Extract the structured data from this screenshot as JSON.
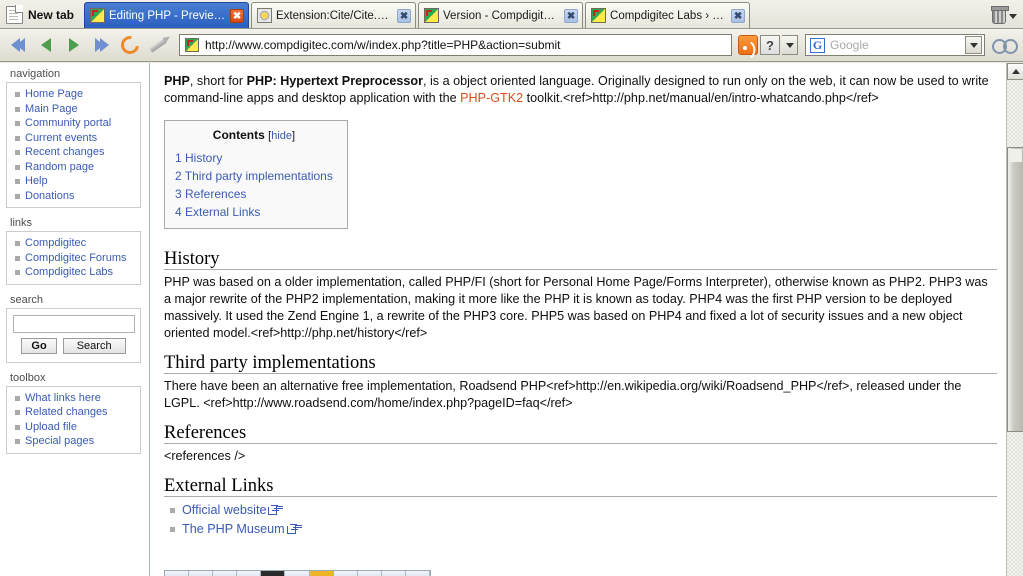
{
  "browser": {
    "new_tab_label": "New tab",
    "trash_icon": "trash-icon",
    "tabs": [
      {
        "title": "Editing PHP - Preview ...",
        "favicon": "compdigitec-favicon",
        "close_label": "✖",
        "active": true
      },
      {
        "title": "Extension:Cite/Cite.ph...",
        "favicon": "mediawiki-favicon",
        "close_label": "✖",
        "active": false
      },
      {
        "title": "Version - Compdigitec...",
        "favicon": "compdigitec-favicon",
        "close_label": "✖",
        "active": false
      },
      {
        "title": "Compdigitec Labs › Cr...",
        "favicon": "compdigitec-favicon",
        "close_label": "✖",
        "active": false
      }
    ],
    "toolbar": {
      "first_icon": "first-page-icon",
      "back_icon": "back-arrow-icon",
      "forward_icon": "forward-arrow-icon",
      "last_icon": "last-page-icon",
      "reload_icon": "reload-icon",
      "stop_icon": "pencil-stop-icon",
      "url": "http://www.compdigitec.com/w/index.php?title=PHP&action=submit",
      "rss_icon": "rss-feed-icon",
      "help_label": "?",
      "help_dropdown_icon": "chevron-down-icon"
    },
    "search": {
      "engine_icon": "google-logo-icon",
      "placeholder": "Google",
      "value": "",
      "dropdown_icon": "chevron-down-icon",
      "glasses_icon": "find-glasses-icon"
    }
  },
  "sidebar": {
    "portlets": [
      {
        "heading": "navigation",
        "items": [
          {
            "label": "Home Page"
          },
          {
            "label": "Main Page"
          },
          {
            "label": "Community portal"
          },
          {
            "label": "Current events"
          },
          {
            "label": "Recent changes"
          },
          {
            "label": "Random page"
          },
          {
            "label": "Help"
          },
          {
            "label": "Donations"
          }
        ]
      },
      {
        "heading": "links",
        "items": [
          {
            "label": "Compdigitec"
          },
          {
            "label": "Compdigitec Forums"
          },
          {
            "label": "Compdigitec Labs"
          }
        ]
      }
    ],
    "search_portlet": {
      "heading": "search",
      "input_value": "",
      "go_label": "Go",
      "search_label": "Search"
    },
    "toolbox": {
      "heading": "toolbox",
      "items": [
        {
          "label": "What links here"
        },
        {
          "label": "Related changes"
        },
        {
          "label": "Upload file"
        },
        {
          "label": "Special pages"
        }
      ]
    }
  },
  "article": {
    "intro": {
      "part1_bold": "PHP",
      "part2": ", short for ",
      "part3_bold": "PHP: Hypertext Preprocessor",
      "part4": ", is a object oriented language. Originally designed to run only on the web, it can now be used to write command-line apps and desktop application with the ",
      "link": "PHP-GTK2",
      "part5": " toolkit.<ref>http://php.net/manual/en/intro-whatcando.php</ref>"
    },
    "toc": {
      "title": "Contents",
      "toggle_open": "[",
      "toggle_label": "hide",
      "toggle_close": "]",
      "items": [
        {
          "label": "1 History"
        },
        {
          "label": "2 Third party implementations"
        },
        {
          "label": "3 References"
        },
        {
          "label": "4 External Links"
        }
      ]
    },
    "sections": [
      {
        "heading": "History",
        "body": "PHP was based on a older implementation, called PHP/FI (short for Personal Home Page/Forms Interpreter), otherwise known as PHP2. PHP3 was a major rewrite of the PHP2 implementation, making it more like the PHP it is known as today. PHP4 was the first PHP version to be deployed massively. It used the Zend Engine 1, a rewrite of the PHP3 core. PHP5 was based on PHP4 and fixed a lot of security issues and a new object oriented model.<ref>http://php.net/history</ref>"
      },
      {
        "heading": "Third party implementations",
        "body": "There have been an alternative free implementation, Roadsend PHP<ref>http://en.wikipedia.org/wiki/Roadsend_PHP</ref>, released under the LGPL. <ref>http://www.roadsend.com/home/index.php?pageID=faq</ref>"
      },
      {
        "heading": "References",
        "body": "<references />"
      }
    ],
    "external_links": {
      "heading": "External Links",
      "items": [
        {
          "label": "Official website",
          "icon": "external-link-icon"
        },
        {
          "label": "The PHP Museum",
          "icon": "external-link-icon"
        }
      ]
    }
  }
}
